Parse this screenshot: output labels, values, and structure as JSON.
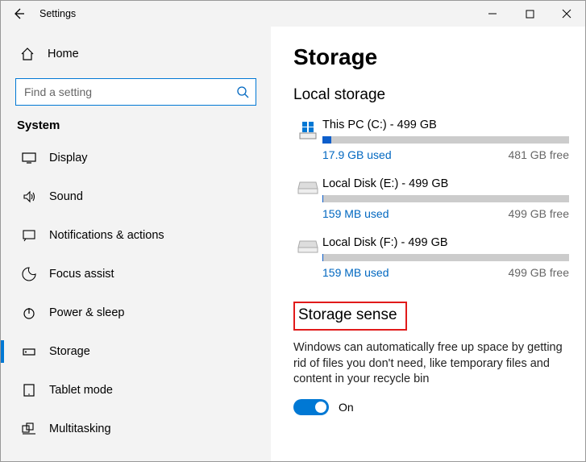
{
  "titlebar": {
    "title": "Settings"
  },
  "sidebar": {
    "home": "Home",
    "search_placeholder": "Find a setting",
    "category": "System",
    "items": [
      {
        "label": "Display"
      },
      {
        "label": "Sound"
      },
      {
        "label": "Notifications & actions"
      },
      {
        "label": "Focus assist"
      },
      {
        "label": "Power & sleep"
      },
      {
        "label": "Storage",
        "selected": true
      },
      {
        "label": "Tablet mode"
      },
      {
        "label": "Multitasking"
      }
    ]
  },
  "main": {
    "title": "Storage",
    "local_title": "Local storage",
    "drives": [
      {
        "title": "This PC (C:) - 499 GB",
        "used": "17.9 GB used",
        "free": "481 GB free",
        "fill_pct": 3.6,
        "is_system": true
      },
      {
        "title": "Local Disk (E:) - 499 GB",
        "used": "159 MB used",
        "free": "499 GB free",
        "fill_pct": 0.2,
        "is_system": false
      },
      {
        "title": "Local Disk (F:) - 499 GB",
        "used": "159 MB used",
        "free": "499 GB free",
        "fill_pct": 0.2,
        "is_system": false
      }
    ],
    "sense_title": "Storage sense",
    "sense_desc": "Windows can automatically free up space by getting rid of files you don't need, like temporary files and content in your recycle bin",
    "toggle_label": "On"
  },
  "colors": {
    "accent": "#0078d4",
    "link": "#0067c0",
    "annotation": "#e11a1a"
  }
}
